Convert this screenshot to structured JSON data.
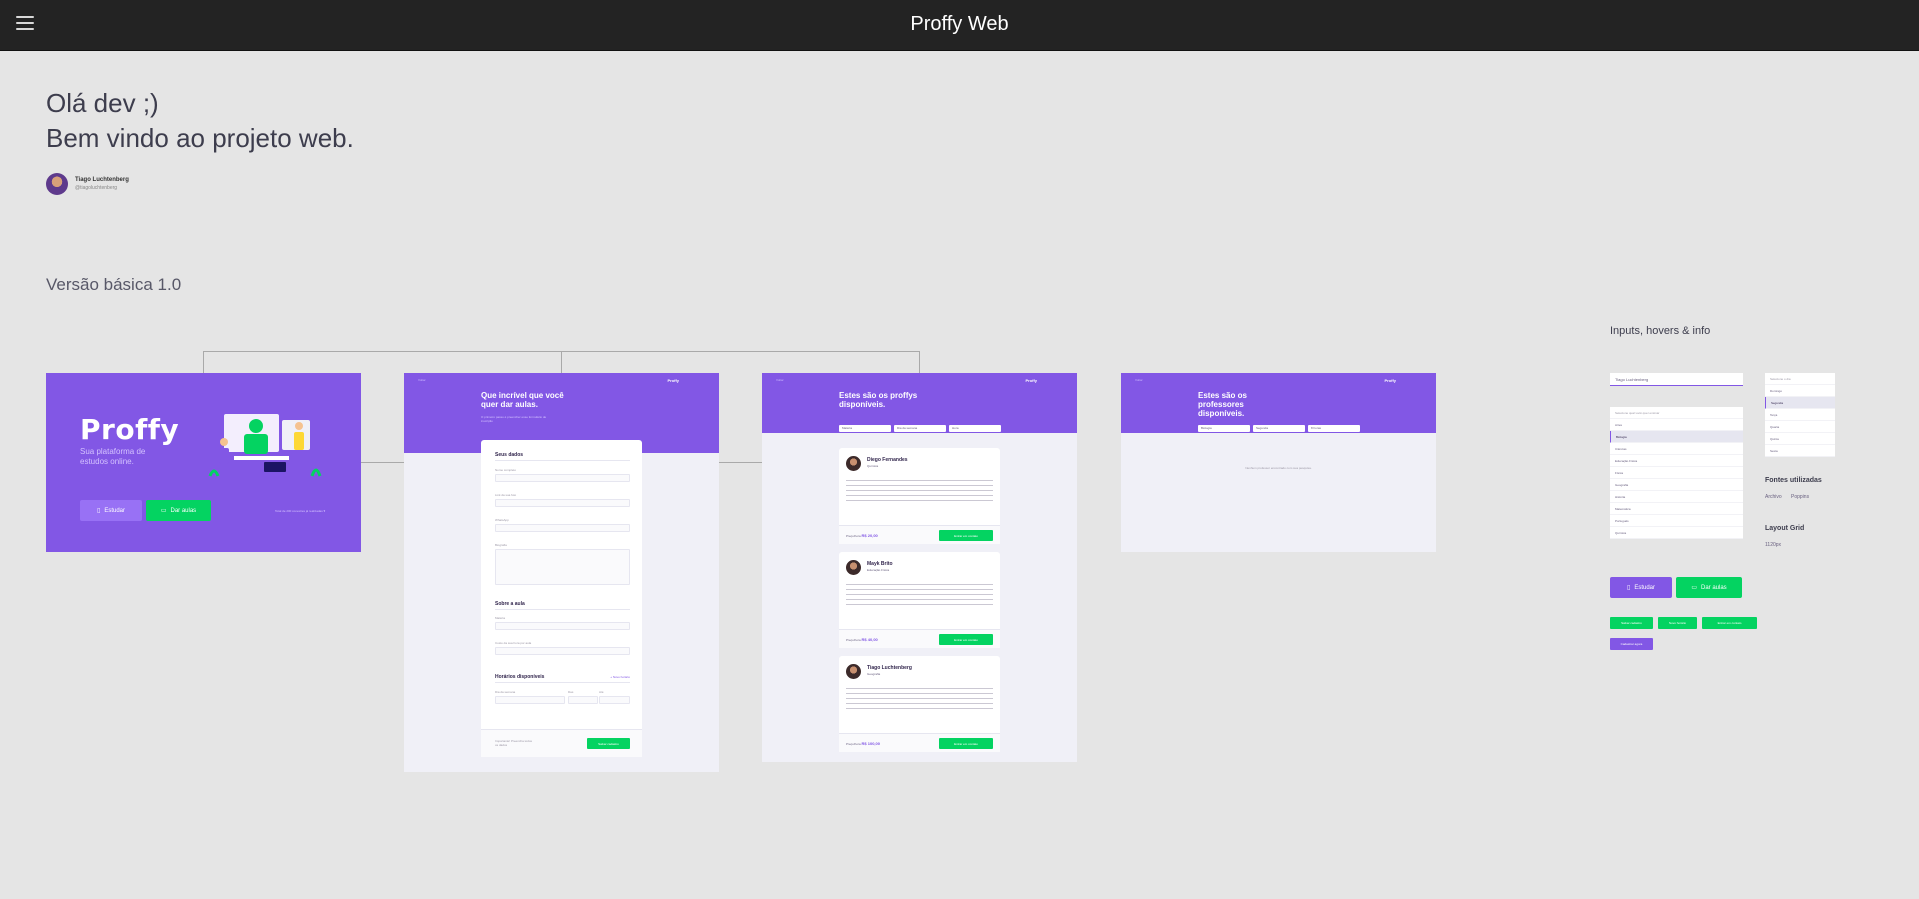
{
  "app": {
    "title": "Proffy Web",
    "menu_icon": "hamburger-icon"
  },
  "intro": {
    "line1": "Olá dev ;)",
    "line2": "Bem vindo ao projeto web.",
    "author_name": "Tiago Luchtenberg",
    "author_handle": "@tiagoluchtenberg"
  },
  "section_title": "Versão básica 1.0",
  "side_title": "Inputs, hovers & info",
  "landing": {
    "logo": "Proffy",
    "tagline": "Sua plataforma de estudos online.",
    "study_label": "Estudar",
    "teach_label": "Dar aulas",
    "footer": "Total de 200 conexões já realizadas ♥"
  },
  "teacher_form": {
    "back": "Voltar",
    "logo": "Proffy",
    "title": "Que incrível que você quer dar aulas.",
    "subtitle": "O primeiro passo é preencher esse formulário de inscrição",
    "section1": "Seus dados",
    "label_name": "Nome completo",
    "label_avatar": "Link da sua foto",
    "label_whatsapp": "WhatsApp",
    "label_bio": "Biografia",
    "section2": "Sobre a aula",
    "label_subject": "Matéria",
    "label_cost": "Custo da sua hora por aula",
    "section3": "Horários disponíveis",
    "new_schedule": "+ Novo horário",
    "label_weekday": "Dia da semana",
    "label_from": "Das",
    "label_to": "Até",
    "warning": "Importante! Preencha todos os dados",
    "save_label": "Salvar cadastro"
  },
  "study_list": {
    "back": "Voltar",
    "logo": "Proffy",
    "title": "Estes são os proffys disponíveis.",
    "filter_subject": "Matéria",
    "filter_day": "Dia da semana",
    "filter_time": "Hora",
    "teachers": [
      {
        "name": "Diego Fernandes",
        "subject": "Química",
        "price_label": "Preço/hora",
        "price": "R$ 20,00",
        "contact_label": "Entrar em contato"
      },
      {
        "name": "Mayk Brito",
        "subject": "Educação Física",
        "price_label": "Preço/hora",
        "price": "R$ 40,00",
        "contact_label": "Entrar em contato"
      },
      {
        "name": "Tiago Luchtenberg",
        "subject": "Geografia",
        "price_label": "Preço/hora",
        "price": "R$ 100,00",
        "contact_label": "Entrar em contato"
      }
    ]
  },
  "empty_list": {
    "back": "Voltar",
    "logo": "Proffy",
    "title": "Estes são os professores disponíveis.",
    "filter_subject_value": "Biologia",
    "filter_day_value": "Segunda",
    "filter_time_value": "8 horas",
    "empty_message": "Nenhum professor encontrado com sua pesquisa."
  },
  "components": {
    "input_value": "Tiago Luchtenberg",
    "select_placeholder": "Selecione qual você quer ensinar",
    "subjects": [
      "Artes",
      "Biologia",
      "Ciências",
      "Educação Física",
      "Física",
      "Geografia",
      "História",
      "Matemática",
      "Português",
      "Química"
    ],
    "subjects_selected_index": 1,
    "weekday_placeholder": "Selecione o dia",
    "weekdays": [
      "Domingo",
      "Segunda",
      "Terça",
      "Quarta",
      "Quinta",
      "Sexta"
    ],
    "weekdays_selected_index": 1,
    "fonts_title": "Fontes utilizadas",
    "font1": "Archivo",
    "font2": "Poppins",
    "grid_title": "Layout Grid",
    "grid_value": "1120px",
    "study_label": "Estudar",
    "teach_label": "Dar aulas",
    "chip1": "Salvar cadastro",
    "chip2": "Novo horário",
    "chip3": "Entrar em contato",
    "chip4": "Cadastrar agora"
  },
  "colors": {
    "purple": "#8257e5",
    "green": "#04d361",
    "topbar": "#232323",
    "background": "#e5e5e5"
  }
}
